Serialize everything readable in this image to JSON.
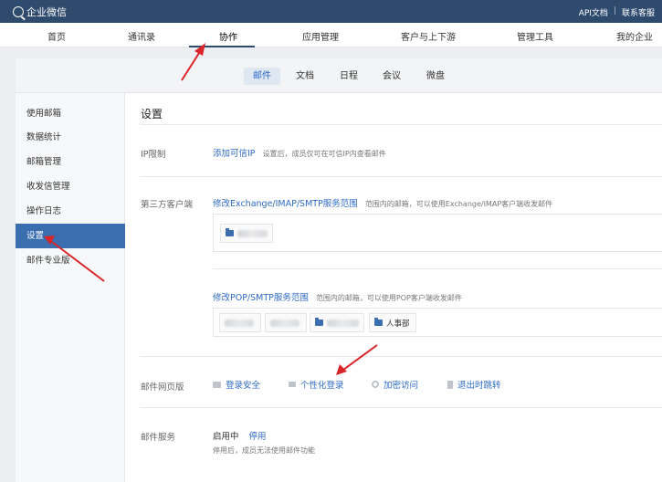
{
  "app": {
    "brand": "企业微信"
  },
  "top_links": {
    "api_docs": "API文档",
    "separator": "|",
    "contact": "联系客服"
  },
  "main_nav": [
    "首页",
    "通讯录",
    "协作",
    "应用管理",
    "客户与上下游",
    "管理工具",
    "我的企业"
  ],
  "main_nav_active": "协作",
  "sub_nav": [
    "邮件",
    "文档",
    "日程",
    "会议",
    "微盘"
  ],
  "sub_nav_active": "邮件",
  "sidebar": [
    "使用邮箱",
    "数据统计",
    "邮箱管理",
    "收发信管理",
    "操作日志",
    "设置",
    "邮件专业版"
  ],
  "sidebar_active": "设置",
  "page_title": "设置",
  "ip_limit": {
    "label": "IP限制",
    "link": "添加可信IP",
    "hint": "设置后，成员仅可在可信IP内查看邮件"
  },
  "third_party": {
    "label": "第三方客户端",
    "exchange_link": "修改Exchange/IMAP/SMTP服务范围",
    "exchange_hint": "范围内的邮箱，可以使用Exchange/IMAP客户端收发邮件",
    "pop_link": "修改POP/SMTP服务范围",
    "pop_hint": "范围内的邮箱，可以使用POP客户端收发邮件",
    "pop_visible_dept": "人事部"
  },
  "web_mail": {
    "label": "邮件网页版",
    "options": [
      "登录安全",
      "个性化登录",
      "加密访问",
      "退出时跳转"
    ]
  },
  "mail_service": {
    "label": "邮件服务",
    "status": "启用中",
    "action": "停用",
    "hint": "停用后，成员无法使用邮件功能"
  },
  "colors": {
    "topbar": "#2e4a6d",
    "accent": "#3a6eaf",
    "link": "#2f6bc5",
    "annotation_arrow": "#d9252a"
  }
}
